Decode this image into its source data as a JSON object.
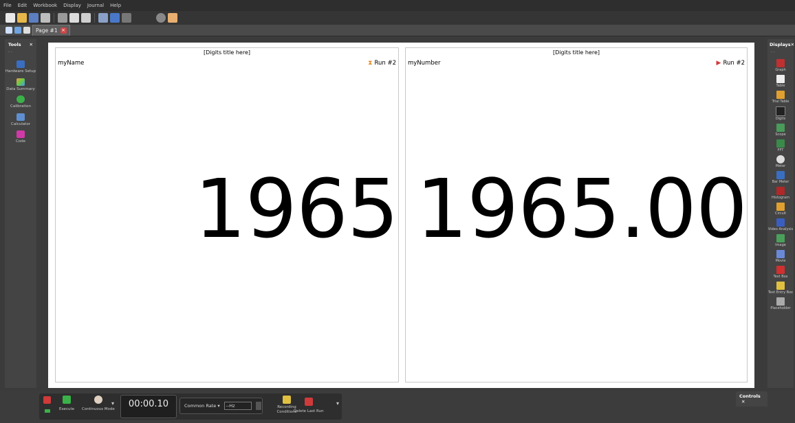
{
  "menu": [
    "File",
    "Edit",
    "Workbook",
    "Display",
    "Journal",
    "Help"
  ],
  "tab": {
    "label": "Page #1"
  },
  "tools_panel": {
    "title": "Tools",
    "items": [
      "Hardware Setup",
      "Data Summary",
      "Calibration",
      "Calculator",
      "Code"
    ]
  },
  "displays_panel": {
    "title": "Displays",
    "items": [
      "Graph",
      "Table",
      "Trial Table",
      "Digits",
      "Scope",
      "FFT",
      "Meter",
      "Bar Meter",
      "Histogram",
      "Circuit",
      "Video Analysis",
      "Image",
      "Movie",
      "Text Box",
      "Text Entry Box",
      "Placeholder"
    ]
  },
  "digits": [
    {
      "title": "[Digits title here]",
      "name": "myName",
      "run": "Run #2",
      "value": "1965"
    },
    {
      "title": "[Digits title here]",
      "name": "myNumber",
      "run": "Run #2",
      "value": "1965.00"
    }
  ],
  "controls": {
    "execute": "Execute",
    "continuous_mode": "Continuous Mode",
    "time": "00:00.10",
    "rate_label": "Common Rate",
    "hz_value": "--Hz",
    "recording_conditions": "Recording Conditions",
    "delete_last_run": "Delete Last Run",
    "panel_title": "Controls"
  },
  "colors": {
    "accent_orange": "#e8891e",
    "accent_red": "#d03a3a"
  }
}
